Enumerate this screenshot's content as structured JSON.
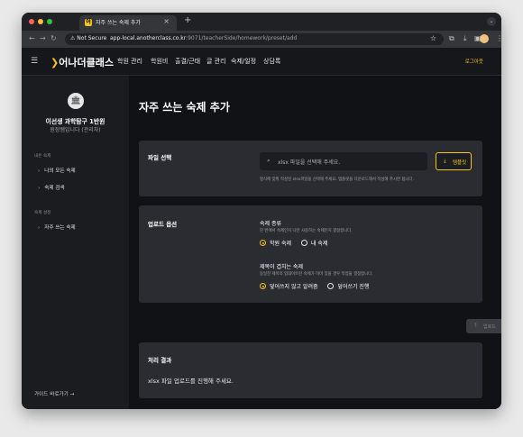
{
  "browser": {
    "tab_title": "자주 쓰는 숙제 추가",
    "tab_close": "×",
    "new_tab": "+",
    "tab_menu": "⌄",
    "security_label": "Not Secure",
    "url_host": "app-local.anotherclass.co.kr",
    "url_path": ":9071/teacherSide/homework/preset/add",
    "icons": [
      "back-icon",
      "forward-icon",
      "reload-icon",
      "star-icon",
      "extensions-icon",
      "download-icon",
      "sidepanel-icon",
      "profile-icon",
      "menu-icon"
    ],
    "colors": {
      "close": "#ff5f57",
      "minimize": "#febc2e",
      "maximize": "#28c840"
    }
  },
  "header": {
    "logo": "어나더클래스",
    "nav": [
      "학원 관리",
      "학원비",
      "출결/근태",
      "글 관리",
      "숙제/일정",
      "상담록"
    ],
    "logout": "로그아웃",
    "accent": "#f5c518"
  },
  "sidebar": {
    "org_name": "이선생 과학탐구 1반원",
    "org_sub": "원장쌤입니다 (관리자)",
    "sections": [
      {
        "title": "내은 숙제",
        "items": [
          "나의 모든 숙제",
          "숙제 검색"
        ]
      },
      {
        "title": "숙제 설정",
        "items": [
          "자주 쓰는 숙제"
        ]
      }
    ],
    "footer": "가이드 바로가기"
  },
  "main": {
    "title": "자주 쓰는 숙제 추가",
    "file_card": {
      "label": "파일 선택",
      "placeholder": "xlsx 파일을 선택해 주세요.",
      "template_button": "템플릿",
      "hint": "형식에 맞춰 작성된 xlsx파일을 선택해 주세요. 템플릿을 다운로드해서 작성해 주시면 됩니다."
    },
    "options_card": {
      "label": "업로드 옵션",
      "homework_type": {
        "title": "숙제 종류",
        "hint": "한 번에서 숙제인지 나만 사용하는 숙제인지 결정합니다.",
        "options": [
          "학원 숙제",
          "내 숙제"
        ],
        "selected": "학원 숙제"
      },
      "duplicate": {
        "title": "제목이 겹치는 숙제",
        "hint": "동일한 제목의 업데이트된 숙제가 이미 있을 경우 작업을 결정합니다.",
        "options": [
          "덮어쓰지 않고 알려줌",
          "덮어쓰기 진행"
        ],
        "selected": "덮어쓰지 않고 알려줌"
      }
    },
    "upload_button": "업로드",
    "result_card": {
      "title": "처리 결과",
      "message": "xlsx 파일 업로드를 진행해 주세요."
    }
  }
}
